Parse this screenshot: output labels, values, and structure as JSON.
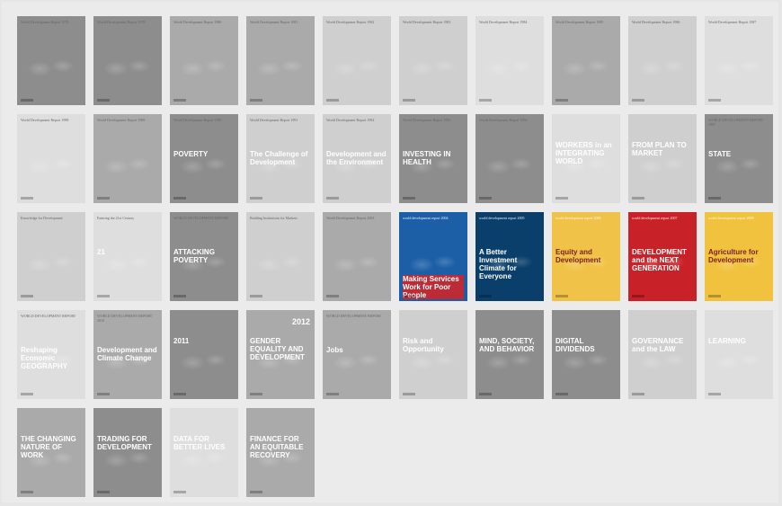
{
  "covers": [
    {
      "title": "World Development Report 1978",
      "tone": "dark"
    },
    {
      "title": "World Development Report 1979",
      "tone": "dark"
    },
    {
      "title": "World Development Report 1980",
      "tone": "mid"
    },
    {
      "title": "World Development Report 1981",
      "tone": "mid"
    },
    {
      "title": "World Development Report 1982",
      "tone": "light"
    },
    {
      "title": "World Development Report 1983",
      "tone": "light"
    },
    {
      "title": "World Development Report 1984",
      "tone": "lighter"
    },
    {
      "title": "World Development Report 1985",
      "tone": "mid"
    },
    {
      "title": "World Development Report 1986",
      "tone": "light"
    },
    {
      "title": "World Development Report 1987",
      "tone": "lighter"
    },
    {
      "title": "World Development Report 1988",
      "tone": "lighter"
    },
    {
      "title": "World Development Report 1989",
      "tone": "mid"
    },
    {
      "title": "World Development Report 1990",
      "big": "POVERTY",
      "tone": "dark"
    },
    {
      "title": "World Development Report 1991",
      "big": "The Challenge of Development",
      "tone": "light"
    },
    {
      "title": "World Development Report 1992",
      "big": "Development and the Environment",
      "tone": "light"
    },
    {
      "title": "World Development Report 1993",
      "big": "INVESTING IN HEALTH",
      "tone": "dark"
    },
    {
      "title": "World Development Report 1994",
      "tone": "dark"
    },
    {
      "title": "",
      "big": "WORKERS in an INTEGRATING WORLD",
      "tone": "lighter"
    },
    {
      "title": "",
      "big": "FROM PLAN TO MARKET",
      "tone": "light"
    },
    {
      "title": "WORLD DEVELOPMENT REPORT 1997",
      "big": "STATE",
      "tone": "dark"
    },
    {
      "title": "Knowledge for Development",
      "tone": "light"
    },
    {
      "title": "Entering the 21st Century",
      "big": "21",
      "tone": "lighter"
    },
    {
      "title": "WORLD DEVELOPMENT REPORT",
      "big": "ATTACKING POVERTY",
      "tone": "dark"
    },
    {
      "title": "Building Institutions for Markets",
      "tone": "light"
    },
    {
      "title": "World Development Report 2003",
      "tone": "mid"
    },
    {
      "title": "world development report 2004",
      "big": "Making Services Work for Poor People",
      "tone": "wdr2004"
    },
    {
      "title": "world development report 2005",
      "big": "A Better Investment Climate for Everyone",
      "tone": "wdr2005"
    },
    {
      "title": "world development report 2006",
      "big": "Equity and Development",
      "tone": "wdr2006"
    },
    {
      "title": "world development report 2007",
      "big": "DEVELOPMENT and the NEXT GENERATION",
      "tone": "wdr2007"
    },
    {
      "title": "world development report 2008",
      "big": "Agriculture for Development",
      "tone": "wdr2008"
    },
    {
      "title": "WORLD DEVELOPMENT REPORT",
      "big": "Reshaping Economic GEOGRAPHY",
      "tone": "lighter"
    },
    {
      "title": "WORLD DEVELOPMENT REPORT 2010",
      "big": "Development and Climate Change",
      "tone": "mid"
    },
    {
      "title": "",
      "big": "2011",
      "tone": "dark"
    },
    {
      "title": "",
      "big": "GENDER EQUALITY AND DEVELOPMENT",
      "year": "2012",
      "tone": "mid"
    },
    {
      "title": "WORLD DEVELOPMENT REPORT",
      "big": "Jobs",
      "tone": "mid"
    },
    {
      "title": "",
      "big": "Risk and Opportunity",
      "tone": "light"
    },
    {
      "title": "",
      "big": "MIND, SOCIETY, AND BEHAVIOR",
      "tone": "dark"
    },
    {
      "title": "",
      "big": "DIGITAL DIVIDENDS",
      "tone": "dark"
    },
    {
      "title": "",
      "big": "GOVERNANCE and the LAW",
      "tone": "light"
    },
    {
      "title": "",
      "big": "LEARNING",
      "tone": "lighter"
    },
    {
      "title": "",
      "big": "THE CHANGING NATURE OF WORK",
      "tone": "mid"
    },
    {
      "title": "",
      "big": "TRADING FOR DEVELOPMENT",
      "tone": "dark"
    },
    {
      "title": "",
      "big": "DATA FOR BETTER LIVES",
      "tone": "lighter"
    },
    {
      "title": "",
      "big": "FINANCE FOR AN EQUITABLE RECOVERY",
      "tone": "mid"
    }
  ],
  "colors": {
    "wdr2004": "#1d5fa6",
    "wdr2005": "#0b3f6b",
    "wdr2006": "#f0c247",
    "wdr2007": "#c82127",
    "wdr2008": "#f1c23e"
  }
}
